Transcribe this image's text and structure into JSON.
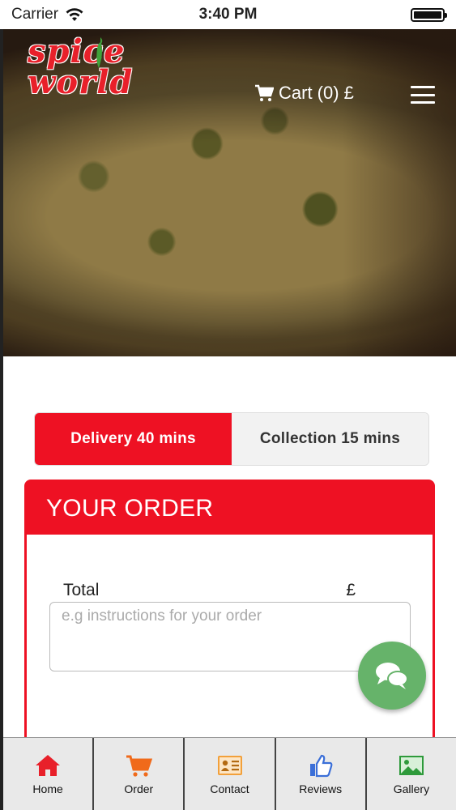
{
  "status_bar": {
    "carrier": "Carrier",
    "time": "3:40 PM"
  },
  "header": {
    "logo_line1": "spice",
    "logo_line2": "world",
    "cart_label": "Cart (0) £"
  },
  "order_type": {
    "delivery_label": "Delivery 40 mins",
    "collection_label": "Collection 15 mins",
    "selected": "delivery"
  },
  "order": {
    "title": "YOUR ORDER",
    "total_label": "Total",
    "total_value": "£",
    "instructions_placeholder": "e.g instructions for your order"
  },
  "bottom_nav": {
    "items": [
      {
        "label": "Home",
        "icon": "home-icon",
        "color": "#e8202a"
      },
      {
        "label": "Order",
        "icon": "cart-icon",
        "color": "#f06a1a"
      },
      {
        "label": "Contact",
        "icon": "contact-card-icon",
        "color": "#f2a03a"
      },
      {
        "label": "Reviews",
        "icon": "thumbs-up-icon",
        "color": "#3b6fd8"
      },
      {
        "label": "Gallery",
        "icon": "image-icon",
        "color": "#2e9a3b"
      }
    ]
  },
  "colors": {
    "accent": "#ee1123",
    "chat_fab": "#66b36a"
  }
}
